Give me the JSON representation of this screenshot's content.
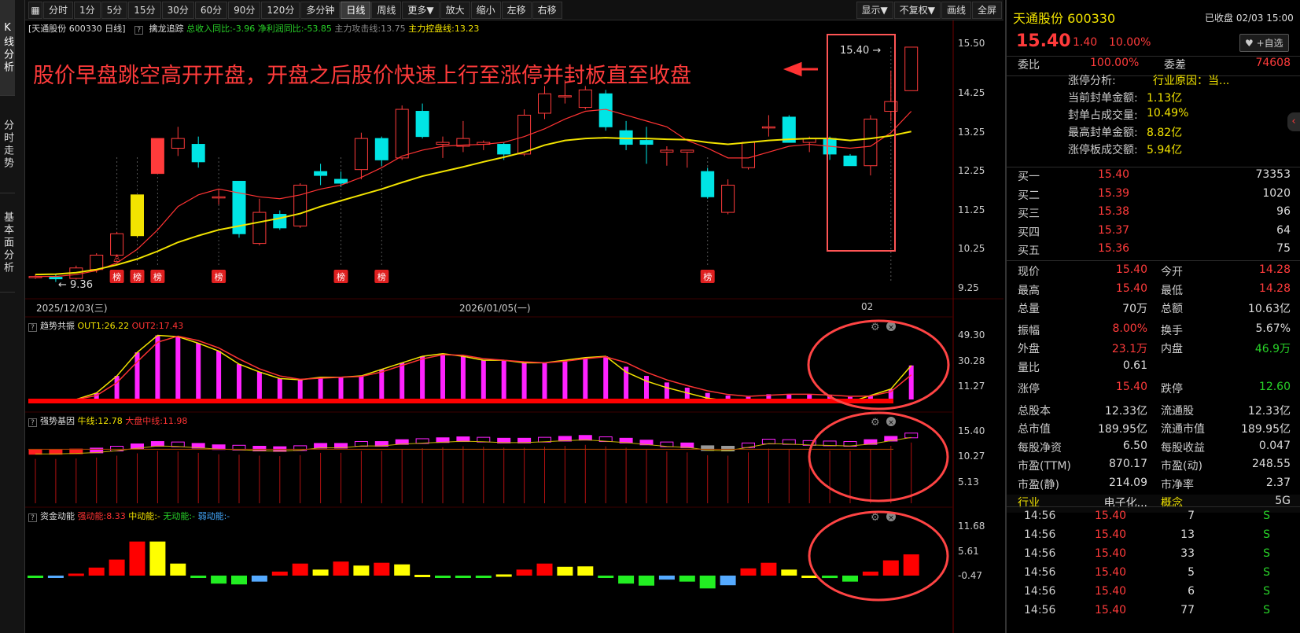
{
  "sidebar": {
    "tabs": [
      "K线分析",
      "分时走势",
      "基本面分析"
    ]
  },
  "toolbar": {
    "period_buttons": [
      "分时",
      "1分",
      "5分",
      "15分",
      "30分",
      "60分",
      "90分",
      "120分",
      "多分钟",
      "日线",
      "周线",
      "更多▼",
      "放大",
      "缩小",
      "左移",
      "右移"
    ],
    "active": "日线",
    "right_buttons": [
      "显示▼",
      "不复权▼",
      "画线",
      "全屏"
    ]
  },
  "main_info": {
    "title": "[天通股份 600330 日线]",
    "indicator": "擒龙追踪",
    "profit_yoy": "总收入同比:-3.96",
    "net_yoy": "净利润同比:-53.85",
    "attack": "主力攻击线:13.75",
    "control": "主力控盘线:13.23"
  },
  "annotation": {
    "text": "股价早盘跳空高开开盘，开盘之后股价快速上行至涨停并封板直至收盘",
    "price_tag": "15.40",
    "low_tag": "9.36",
    "bang": "榜"
  },
  "price_axis": [
    "15.50",
    "14.25",
    "13.25",
    "12.25",
    "11.25",
    "10.25",
    "9.25"
  ],
  "date_axis": [
    "2025/12/03(三)",
    "2026/01/05(一)",
    "02"
  ],
  "colors": {
    "up": "#ff3b3b",
    "down": "#00e5e5",
    "ma_yellow": "#f2e300",
    "ma_red": "#ff3333",
    "bg": "#000000"
  },
  "chart_data": [
    {
      "type": "candlestick",
      "title": "天通股份 600330 日线",
      "ylim": [
        9.25,
        15.5
      ],
      "ohlc": [
        [
          9.48,
          9.56,
          9.44,
          9.5
        ],
        [
          9.48,
          9.55,
          9.36,
          9.44
        ],
        [
          9.45,
          9.78,
          9.42,
          9.72
        ],
        [
          9.68,
          10.1,
          9.6,
          10.05
        ],
        [
          10.05,
          10.65,
          10.0,
          10.6
        ],
        [
          10.55,
          11.6,
          10.5,
          11.6
        ],
        [
          12.55,
          12.55,
          12.55,
          12.55
        ],
        [
          12.8,
          13.35,
          12.6,
          13.05
        ],
        [
          12.9,
          13.1,
          12.3,
          12.45
        ],
        [
          11.55,
          11.72,
          11.35,
          11.55
        ],
        [
          11.95,
          11.95,
          10.5,
          10.6
        ],
        [
          10.35,
          11.5,
          10.3,
          11.15
        ],
        [
          11.1,
          11.2,
          10.7,
          10.75
        ],
        [
          10.8,
          11.9,
          10.75,
          11.85
        ],
        [
          12.2,
          12.4,
          11.85,
          12.1
        ],
        [
          12.0,
          12.2,
          11.8,
          11.9
        ],
        [
          12.25,
          13.2,
          12.0,
          13.05
        ],
        [
          13.05,
          13.1,
          12.35,
          12.5
        ],
        [
          12.55,
          13.9,
          12.5,
          13.8
        ],
        [
          13.75,
          13.95,
          13.05,
          13.1
        ],
        [
          12.9,
          13.1,
          12.55,
          12.95
        ],
        [
          12.85,
          13.5,
          12.7,
          13.05
        ],
        [
          12.9,
          13.0,
          12.75,
          12.95
        ],
        [
          12.9,
          12.95,
          12.5,
          12.65
        ],
        [
          12.65,
          13.8,
          12.6,
          13.65
        ],
        [
          13.7,
          14.4,
          13.55,
          14.2
        ],
        [
          14.15,
          14.55,
          13.95,
          14.15
        ],
        [
          13.85,
          14.4,
          13.8,
          14.3
        ],
        [
          14.2,
          14.3,
          13.25,
          13.35
        ],
        [
          13.25,
          13.5,
          12.75,
          12.9
        ],
        [
          13.0,
          13.35,
          12.4,
          12.9
        ],
        [
          12.7,
          12.85,
          12.35,
          12.75
        ],
        [
          12.7,
          12.75,
          12.3,
          12.75
        ],
        [
          12.2,
          12.3,
          11.5,
          11.55
        ],
        [
          11.15,
          12.0,
          11.1,
          11.85
        ],
        [
          12.3,
          12.9,
          12.25,
          12.95
        ],
        [
          13.35,
          13.65,
          13.1,
          13.35
        ],
        [
          13.6,
          13.65,
          12.95,
          12.95
        ],
        [
          12.95,
          13.1,
          12.7,
          13.05
        ],
        [
          13.05,
          13.1,
          12.5,
          12.65
        ],
        [
          12.6,
          12.65,
          12.35,
          12.35
        ],
        [
          12.35,
          13.65,
          12.1,
          13.55
        ],
        [
          13.75,
          14.8,
          13.5,
          14.0
        ],
        [
          14.28,
          15.4,
          14.28,
          15.4
        ]
      ],
      "ma_yellow": [
        9.55,
        9.56,
        9.6,
        9.68,
        9.8,
        9.95,
        10.15,
        10.38,
        10.55,
        10.7,
        10.8,
        10.9,
        11.0,
        11.12,
        11.3,
        11.45,
        11.6,
        11.75,
        11.92,
        12.08,
        12.2,
        12.32,
        12.45,
        12.57,
        12.7,
        12.88,
        13.0,
        13.05,
        13.07,
        13.05,
        13.05,
        13.03,
        13.02,
        12.95,
        12.9,
        12.95,
        13.0,
        13.03,
        13.05,
        13.05,
        13.0,
        13.05,
        13.12,
        13.23
      ],
      "ma_red": [
        9.5,
        9.5,
        9.55,
        9.65,
        9.85,
        10.2,
        10.7,
        11.3,
        11.6,
        11.75,
        11.65,
        11.55,
        11.5,
        11.6,
        11.75,
        11.85,
        12.05,
        12.3,
        12.6,
        12.75,
        12.85,
        12.88,
        12.9,
        12.95,
        13.1,
        13.3,
        13.55,
        13.75,
        13.8,
        13.65,
        13.5,
        13.35,
        13.0,
        12.8,
        12.55,
        12.55,
        12.7,
        12.85,
        12.9,
        12.85,
        12.8,
        12.85,
        13.2,
        13.75
      ],
      "bang_markers": [
        4,
        5,
        6,
        9,
        15,
        17,
        33
      ]
    },
    {
      "type": "bar",
      "title": "趋势共振",
      "legend": [
        "OUT1:26.22",
        "OUT2:17.43"
      ],
      "yticks": [
        "49.30",
        "30.28",
        "11.27"
      ],
      "ylim": [
        0,
        55
      ],
      "values": [
        0,
        0,
        0,
        5,
        18,
        36,
        49,
        48,
        43,
        37,
        27,
        21,
        16,
        15,
        17,
        17,
        18,
        23,
        28,
        33,
        35,
        33,
        30,
        30,
        28,
        28,
        30,
        32,
        33,
        25,
        18,
        13,
        9,
        5,
        3,
        2,
        4,
        4,
        4,
        3,
        2,
        3,
        8,
        26
      ]
    },
    {
      "type": "bar",
      "title": "强势基因",
      "legend": [
        "牛线:12.78",
        "大盘中线:11.98"
      ],
      "yticks": [
        "15.40",
        "10.27",
        "5.13"
      ],
      "ylim": [
        0,
        18
      ],
      "values": [
        10.6,
        10.6,
        10.7,
        10.9,
        11.3,
        11.8,
        12.3,
        12.2,
        11.9,
        11.6,
        11.5,
        11.3,
        11.2,
        11.4,
        11.9,
        11.9,
        12.3,
        12.3,
        12.7,
        12.9,
        13.1,
        13.3,
        13.2,
        13.0,
        13.0,
        13.2,
        13.4,
        13.6,
        13.3,
        13.0,
        12.6,
        12.2,
        12.0,
        11.4,
        11.3,
        12.0,
        12.8,
        12.7,
        12.5,
        12.4,
        12.3,
        12.7,
        13.4,
        14.1
      ]
    },
    {
      "type": "bar",
      "title": "资金动能",
      "legend": [
        "强动能:8.33",
        "中动能:-",
        "无动能:-",
        "弱动能:-"
      ],
      "yticks": [
        "11.68",
        "5.61",
        "-0.47"
      ],
      "ylim": [
        -3.5,
        12
      ],
      "values": [
        -0.5,
        -0.5,
        0.5,
        2,
        4,
        8.5,
        8.5,
        3,
        0,
        -2,
        -2.2,
        -1.5,
        1,
        3,
        1.5,
        3.5,
        2.5,
        3.2,
        2.8,
        0.2,
        -0.5,
        0,
        -0.4,
        0.3,
        1.5,
        3,
        2.2,
        2.3,
        0,
        -2,
        -2.5,
        -1,
        -1.5,
        -3.2,
        -2.4,
        1.8,
        3.2,
        1.5,
        0,
        -0.6,
        -1.5,
        1,
        3.8,
        5.3
      ],
      "colors": [
        "g",
        "b",
        "r",
        "r",
        "r",
        "r",
        "y",
        "y",
        "g",
        "g",
        "g",
        "b",
        "r",
        "r",
        "y",
        "r",
        "y",
        "r",
        "y",
        "y",
        "g",
        "g",
        "g",
        "y",
        "r",
        "r",
        "y",
        "y",
        "g",
        "g",
        "g",
        "b",
        "g",
        "g",
        "b",
        "r",
        "r",
        "y",
        "y",
        "g",
        "g",
        "r",
        "r",
        "r"
      ]
    }
  ],
  "right_panel": {
    "stock_name": "天通股份 600330",
    "status": "已收盘 02/03 15:00",
    "price": "15.40",
    "change": "1.40",
    "pct": "10.00%",
    "watch": "♥ +自选",
    "wei_bi_label": "委比",
    "wei_bi": "100.00%",
    "wei_cha_label": "委差",
    "wei_cha": "74608",
    "limit_info": [
      {
        "k": "涨停分析:",
        "v": "行业原因：当..."
      },
      {
        "k": "当前封单金额:",
        "v": "1.13亿"
      },
      {
        "k": "封单占成交量:",
        "v": "10.49%"
      },
      {
        "k": "最高封单金额:",
        "v": "8.82亿"
      },
      {
        "k": "涨停板成交额:",
        "v": "5.94亿"
      }
    ],
    "bids": [
      {
        "k": "买一",
        "p": "15.40",
        "v": "73353"
      },
      {
        "k": "买二",
        "p": "15.39",
        "v": "1020"
      },
      {
        "k": "买三",
        "p": "15.38",
        "v": "96"
      },
      {
        "k": "买四",
        "p": "15.37",
        "v": "64"
      },
      {
        "k": "买五",
        "p": "15.36",
        "v": "75"
      }
    ],
    "quote": [
      [
        "现价",
        "15.40",
        "今开",
        "14.28"
      ],
      [
        "最高",
        "15.40",
        "最低",
        "14.28"
      ],
      [
        "总量",
        "70万",
        "总额",
        "10.63亿"
      ],
      [
        "振幅",
        "8.00%",
        "换手",
        "5.67%"
      ],
      [
        "外盘",
        "23.1万",
        "内盘",
        "46.9万"
      ],
      [
        "量比",
        "0.61",
        "",
        ""
      ],
      [
        "涨停",
        "15.40",
        "跌停",
        "12.60"
      ],
      [
        "总股本",
        "12.33亿",
        "流通股",
        "12.33亿"
      ],
      [
        "总市值",
        "189.95亿",
        "流通市值",
        "189.95亿"
      ],
      [
        "每股净资",
        "6.50",
        "每股收益",
        "0.047"
      ],
      [
        "市盈(TTM)",
        "870.17",
        "市盈(动)",
        "248.55"
      ],
      [
        "市盈(静)",
        "214.09",
        "市净率",
        "2.37"
      ],
      [
        "行业",
        "电子化...",
        "概念",
        "5G"
      ]
    ],
    "ticks": [
      [
        "14:56",
        "15.40",
        "7",
        "S"
      ],
      [
        "14:56",
        "15.40",
        "13",
        "S"
      ],
      [
        "14:56",
        "15.40",
        "33",
        "S"
      ],
      [
        "14:56",
        "15.40",
        "5",
        "S"
      ],
      [
        "14:56",
        "15.40",
        "6",
        "S"
      ],
      [
        "14:56",
        "15.40",
        "77",
        "S"
      ]
    ]
  }
}
